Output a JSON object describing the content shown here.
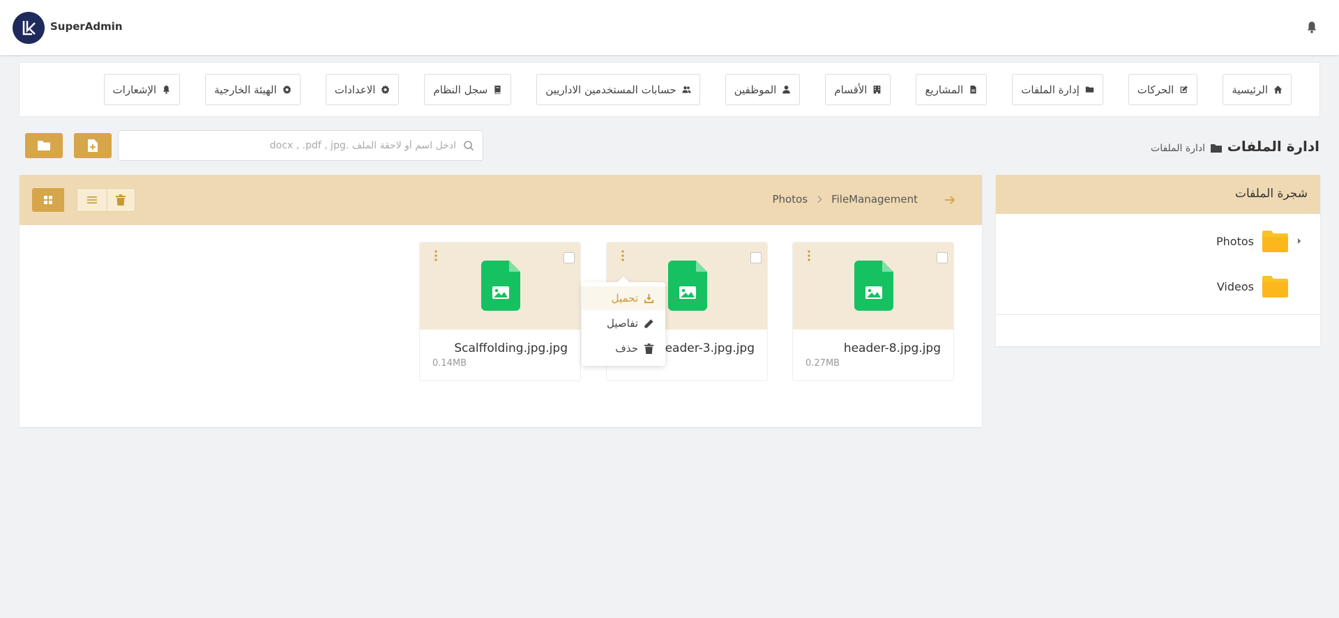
{
  "app": {
    "brand": "SuperAdmin"
  },
  "nav": [
    {
      "label": "الرئيسية",
      "icon": "home-icon"
    },
    {
      "label": "الحركات",
      "icon": "edit-icon"
    },
    {
      "label": "إدارة الملفات",
      "icon": "folder-icon"
    },
    {
      "label": "المشاريع",
      "icon": "file-icon"
    },
    {
      "label": "الأقسام",
      "icon": "building-icon"
    },
    {
      "label": "الموظفين",
      "icon": "user-icon"
    },
    {
      "label": "حسابات المستخدمين الاداريين",
      "icon": "users-icon"
    },
    {
      "label": "سجل النظام",
      "icon": "book-icon"
    },
    {
      "label": "الاعدادات",
      "icon": "gear-icon"
    },
    {
      "label": "الهيئة الخارجية",
      "icon": "gear-icon"
    },
    {
      "label": "الإشعارات",
      "icon": "bell-icon"
    }
  ],
  "page": {
    "title": "ادارة الملفات",
    "breadcrumb": "ادارة الملفات"
  },
  "search": {
    "placeholder": "ادخل اسم أو لاحقة الملف .docx , .pdf , jpg"
  },
  "explorer": {
    "path": [
      "FileManagement",
      "Photos"
    ],
    "files": [
      {
        "name": "header-8.jpg.jpg",
        "size": "0.27MB"
      },
      {
        "name": "header-3.jpg.jpg",
        "size": ""
      },
      {
        "name": "Scalffolding.jpg.jpg",
        "size": "0.14MB"
      }
    ],
    "context_menu": [
      {
        "label": "تحميل",
        "icon": "download-icon"
      },
      {
        "label": "تفاصيل",
        "icon": "pencil-icon"
      },
      {
        "label": "حذف",
        "icon": "trash-icon"
      }
    ]
  },
  "tree": {
    "title": "شجرة الملفات",
    "items": [
      {
        "label": "Photos"
      },
      {
        "label": "Videos"
      }
    ]
  },
  "colors": {
    "accent": "#d7a54a",
    "header_bg": "#efd9b3",
    "file_green": "#16c161",
    "folder_yellow": "#f7c325"
  }
}
